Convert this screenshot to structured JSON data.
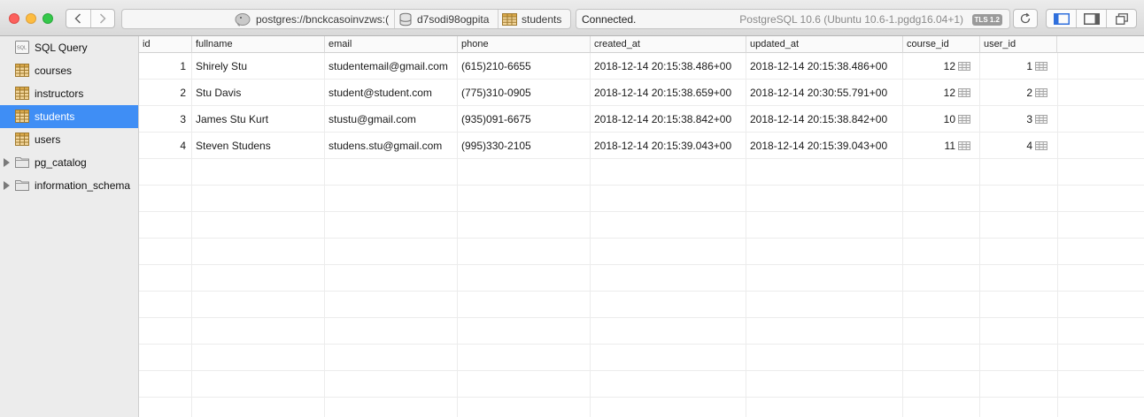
{
  "window": {
    "nav_back_icon": "chevron-left-icon",
    "nav_forward_icon": "chevron-right-icon"
  },
  "breadcrumb": {
    "server": "postgres://bnckcasoinvzws:(",
    "database": "d7sodi98ogpita",
    "table": "students"
  },
  "status": {
    "connection": "Connected.",
    "server_version": "PostgreSQL 10.6 (Ubuntu 10.6-1.pgdg16.04+1)",
    "tls_badge": "TLS 1.2"
  },
  "toolbar_icons": [
    "refresh-icon",
    "sidebar-left-icon",
    "sidebar-right-icon",
    "windows-icon"
  ],
  "sidebar": {
    "items": [
      {
        "label": "SQL Query",
        "icon": "sql-query-icon",
        "kind": "query"
      },
      {
        "label": "courses",
        "icon": "table-icon",
        "kind": "table"
      },
      {
        "label": "instructors",
        "icon": "table-icon",
        "kind": "table"
      },
      {
        "label": "students",
        "icon": "table-icon",
        "kind": "table",
        "active": true
      },
      {
        "label": "users",
        "icon": "table-icon",
        "kind": "table"
      },
      {
        "label": "pg_catalog",
        "icon": "folder-icon",
        "kind": "schema"
      },
      {
        "label": "information_schema",
        "icon": "folder-icon",
        "kind": "schema"
      }
    ]
  },
  "table": {
    "columns": [
      "id",
      "fullname",
      "email",
      "phone",
      "created_at",
      "updated_at",
      "course_id",
      "user_id"
    ],
    "rows": [
      [
        "1",
        "Shirely Stu",
        "studentemail@gmail.com",
        "(615)210-6655",
        "2018-12-14 20:15:38.486+00",
        "2018-12-14 20:15:38.486+00",
        "12",
        "1"
      ],
      [
        "2",
        "Stu Davis",
        "student@student.com",
        "(775)310-0905",
        "2018-12-14 20:15:38.659+00",
        "2018-12-14 20:30:55.791+00",
        "12",
        "2"
      ],
      [
        "3",
        "James Stu Kurt",
        "stustu@gmail.com",
        "(935)091-6675",
        "2018-12-14 20:15:38.842+00",
        "2018-12-14 20:15:38.842+00",
        "10",
        "3"
      ],
      [
        "4",
        "Steven Studens",
        "studens.stu@gmail.com",
        "(995)330-2105",
        "2018-12-14 20:15:39.043+00",
        "2018-12-14 20:15:39.043+00",
        "11",
        "4"
      ]
    ]
  }
}
